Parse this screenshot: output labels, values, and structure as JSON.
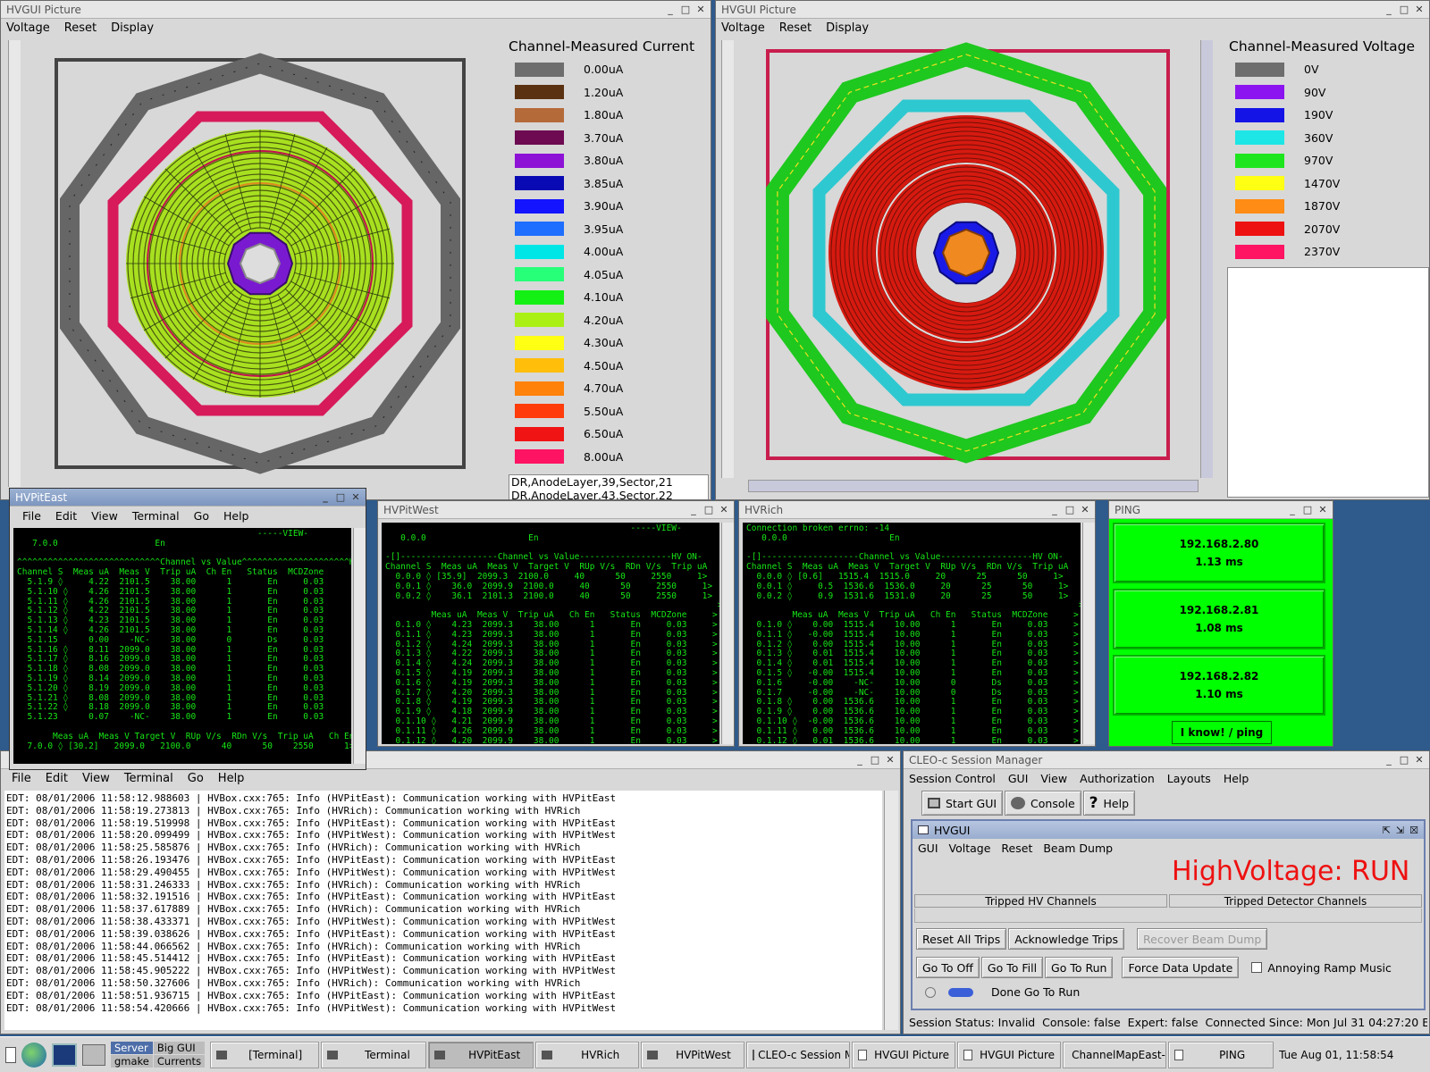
{
  "colors": {
    "bg": "#2f5a8c",
    "term_green": "#17e617",
    "ping_green": "#00ff00",
    "run_red": "#ee1111"
  },
  "win_current": {
    "title": "HVGUI Picture",
    "menu": [
      "Voltage",
      "Reset",
      "Display"
    ],
    "legend_title": "Channel-Measured Current",
    "legend": [
      {
        "color": "#6e6e6e",
        "label": "0.00uA"
      },
      {
        "color": "#5a3212",
        "label": "1.20uA"
      },
      {
        "color": "#b56a3a",
        "label": "1.80uA"
      },
      {
        "color": "#6e0a52",
        "label": "3.70uA"
      },
      {
        "color": "#8e12d6",
        "label": "3.80uA"
      },
      {
        "color": "#0a0ab4",
        "label": "3.85uA"
      },
      {
        "color": "#1414ff",
        "label": "3.90uA"
      },
      {
        "color": "#1e6eff",
        "label": "3.95uA"
      },
      {
        "color": "#00e6e6",
        "label": "4.00uA"
      },
      {
        "color": "#28ff78",
        "label": "4.05uA"
      },
      {
        "color": "#14f014",
        "label": "4.10uA"
      },
      {
        "color": "#aaf014",
        "label": "4.20uA"
      },
      {
        "color": "#ffff14",
        "label": "4.30uA"
      },
      {
        "color": "#ffbe0a",
        "label": "4.50uA"
      },
      {
        "color": "#ff820a",
        "label": "4.70uA"
      },
      {
        "color": "#ff3c0a",
        "label": "5.50uA"
      },
      {
        "color": "#f01414",
        "label": "6.50uA"
      },
      {
        "color": "#ff1464",
        "label": "8.00uA"
      }
    ],
    "info_lines": [
      "DR,AnodeLayer,39,Sector,21",
      "DR,AnodeLayer,43,Sector,22"
    ]
  },
  "win_voltage": {
    "title": "HVGUI Picture",
    "menu": [
      "Voltage",
      "Reset",
      "Display"
    ],
    "legend_title": "Channel-Measured Voltage",
    "legend": [
      {
        "color": "#6e6e6e",
        "label": "0V"
      },
      {
        "color": "#8c14f0",
        "label": "90V"
      },
      {
        "color": "#1414e6",
        "label": "190V"
      },
      {
        "color": "#1ee6e6",
        "label": "360V"
      },
      {
        "color": "#1ee61e",
        "label": "970V"
      },
      {
        "color": "#ffff14",
        "label": "1470V"
      },
      {
        "color": "#ff8c14",
        "label": "1870V"
      },
      {
        "color": "#ee1111",
        "label": "2070V"
      },
      {
        "color": "#ff1464",
        "label": "2370V"
      }
    ]
  },
  "hvpiteast": {
    "title": "HVPitEast",
    "menu": [
      "File",
      "Edit",
      "View",
      "Terminal",
      "Go",
      "Help"
    ],
    "text": "                                               -----VIEW-\n   7.0.0                   En\n\n^^^^^^^^^^^^^^^^^^^^^^^^^^^^Channel vs Value^^^^^^^^^^^^^^^^^^^^^HV ON^\nChannel S  Meas uA  Meas V  Trip uA  Ch En   Status  MCDZone      >\n  5.1.9 ◊     4.22  2101.5    38.00      1       En     0.03      >\n  5.1.10 ◊    4.26  2101.5    38.00      1       En     0.03      >\n  5.1.11 ◊    4.26  2101.5    38.00      1       En     0.03      >\n  5.1.12 ◊    4.22  2101.5    38.00      1       En     0.03      >\n  5.1.13 ◊    4.23  2101.5    38.00      1       En     0.03      >\n  5.1.14 ◊    4.26  2101.5    38.00      1       En     0.03      >\n  5.1.15      0.00    -NC-    38.00      0       Ds     0.03      >\n  5.1.16 ◊    8.11  2099.0    38.00      1       En     0.03      >\n  5.1.17 ◊    8.16  2099.0    38.00      1       En     0.03      >\n  5.1.18 ◊    8.08  2099.0    38.00      1       En     0.03      >\n  5.1.19 ◊    8.14  2099.0    38.00      1       En     0.03      >\n  5.1.20 ◊    8.19  2099.0    38.00      1       En     0.03      >\n  5.1.21 ◊    8.08  2099.0    38.00      1       En     0.03      >\n  5.1.22 ◊    8.18  2099.0    38.00      1       En     0.03      >\n  5.1.23      0.07    -NC-    38.00      1       En     0.03      >\n\n       Meas uA  Meas V Target V  RUp V/s  RDn V/s  Trip uA   Ch En>\n  7.0.0 ◊ [30.2]   2099.0   2100.0      40      50    2550      1>"
  },
  "hvpitwest": {
    "title": "HVPitWest",
    "text": "                                                -----VIEW-\n   0.0.0                    En\n\n-[]-------------------Channel vs Value------------------HV ON-\nChannel S  Meas uA  Meas V  Target V  RUp V/s  RDn V/s  Trip uA   Ch En\n  0.0.0 ◊ [35.9]  2099.3  2100.0     40      50     2550     1>\n  0.0.1 ◊    36.0  2099.9  2100.0     40      50     2550     1>\n  0.0.2 ◊    36.1  2101.3  2100.0     40      50     2550     1>\n                                                                 >\n         Meas uA  Meas V  Trip uA   Ch En   Status  MCDZone     >\n  0.1.0 ◊    4.23  2099.3    38.00      1       En     0.03     >\n  0.1.1 ◊    4.23  2099.3    38.00      1       En     0.03     >\n  0.1.2 ◊    4.24  2099.3    38.00      1       En     0.03     >\n  0.1.3 ◊    4.22  2099.3    38.00      1       En     0.03     >\n  0.1.4 ◊    4.24  2099.3    38.00      1       En     0.03     >\n  0.1.5 ◊    4.19  2099.3    38.00      1       En     0.03     >\n  0.1.6 ◊    4.19  2099.3    38.00      1       En     0.03     >\n  0.1.7 ◊    4.20  2099.3    38.00      1       En     0.03     >\n  0.1.8 ◊    4.19  2099.3    38.00      1       En     0.03     >\n  0.1.9 ◊    4.18  2099.9    38.00      1       En     0.03     >\n  0.1.10 ◊   4.21  2099.9    38.00      1       En     0.03     >\n  0.1.11 ◊   4.26  2099.9    38.00      1       En     0.03     >\n  0.1.12 ◊   4.20  2099.9    38.00      1       En     0.03     >"
  },
  "hvrich": {
    "title": "HVRich",
    "text": "Connection broken errno: -14\n   0.0.0                    En\n\n-[]-------------------Channel vs Value------------------HV ON-\nChannel S  Meas uA  Meas V  Target V  RUp V/s  RDn V/s  Trip uA   Ch En\n  0.0.0 ◊ [0.6]   1515.4  1515.0     20      25      50     1>\n  0.0.1 ◊     0.5  1536.6  1536.0     20      25      50     1>\n  0.0.2 ◊     0.9  1531.6  1531.0     20      25      50     1>\n                                                                 >\n         Meas uA  Meas V  Trip uA   Ch En   Status  MCDZone     >\n  0.1.0 ◊    0.00  1515.4    10.00      1       En     0.03     >\n  0.1.1 ◊   -0.00  1515.4    10.00      1       En     0.03     >\n  0.1.2 ◊    0.00  1515.4    10.00      1       En     0.03     >\n  0.1.3 ◊    0.01  1515.4    10.00      1       En     0.03     >\n  0.1.4 ◊    0.01  1515.4    10.00      1       En     0.03     >\n  0.1.5 ◊   -0.00  1515.4    10.00      1       En     0.03     >\n  0.1.6     -0.00    -NC-    10.00      0       Ds     0.03     >\n  0.1.7     -0.00    -NC-    10.00      0       Ds     0.03     >\n  0.1.8 ◊    0.00  1536.6    10.00      1       En     0.03     >\n  0.1.9 ◊    0.00  1536.6    10.00      1       En     0.03     >\n  0.1.10 ◊  -0.00  1536.6    10.00      1       En     0.03     >\n  0.1.11 ◊   0.00  1536.6    10.00      1       En     0.03     >\n  0.1.12 ◊   0.01  1536.6    10.00      1       En     0.03     >"
  },
  "ping": {
    "title": "PING",
    "hosts": [
      {
        "ip": "192.168.2.80",
        "ms": "1.13 ms"
      },
      {
        "ip": "192.168.2.81",
        "ms": "1.08 ms"
      },
      {
        "ip": "192.168.2.82",
        "ms": "1.10 ms"
      }
    ],
    "button": "I know! / ping"
  },
  "terminal": {
    "menu": [
      "File",
      "Edit",
      "View",
      "Terminal",
      "Go",
      "Help"
    ],
    "log": "EDT: 08/01/2006 11:58:12.988603 | HVBox.cxx:765: Info (HVPitEast): Communication working with HVPitEast\nEDT: 08/01/2006 11:58:19.273813 | HVBox.cxx:765: Info (HVRich): Communication working with HVRich\nEDT: 08/01/2006 11:58:19.519998 | HVBox.cxx:765: Info (HVPitEast): Communication working with HVPitEast\nEDT: 08/01/2006 11:58:20.099499 | HVBox.cxx:765: Info (HVPitWest): Communication working with HVPitWest\nEDT: 08/01/2006 11:58:25.585876 | HVBox.cxx:765: Info (HVRich): Communication working with HVRich\nEDT: 08/01/2006 11:58:26.193476 | HVBox.cxx:765: Info (HVPitEast): Communication working with HVPitEast\nEDT: 08/01/2006 11:58:29.490455 | HVBox.cxx:765: Info (HVPitWest): Communication working with HVPitWest\nEDT: 08/01/2006 11:58:31.246333 | HVBox.cxx:765: Info (HVRich): Communication working with HVRich\nEDT: 08/01/2006 11:58:32.191516 | HVBox.cxx:765: Info (HVPitEast): Communication working with HVPitEast\nEDT: 08/01/2006 11:58:37.617889 | HVBox.cxx:765: Info (HVRich): Communication working with HVRich\nEDT: 08/01/2006 11:58:38.433371 | HVBox.cxx:765: Info (HVPitWest): Communication working with HVPitWest\nEDT: 08/01/2006 11:58:39.038626 | HVBox.cxx:765: Info (HVPitEast): Communication working with HVPitEast\nEDT: 08/01/2006 11:58:44.066562 | HVBox.cxx:765: Info (HVRich): Communication working with HVRich\nEDT: 08/01/2006 11:58:45.514412 | HVBox.cxx:765: Info (HVPitEast): Communication working with HVPitEast\nEDT: 08/01/2006 11:58:45.905222 | HVBox.cxx:765: Info (HVPitWest): Communication working with HVPitWest\nEDT: 08/01/2006 11:58:50.327606 | HVBox.cxx:765: Info (HVRich): Communication working with HVRich\nEDT: 08/01/2006 11:58:51.936715 | HVBox.cxx:765: Info (HVPitEast): Communication working with HVPitEast\nEDT: 08/01/2006 11:58:54.420666 | HVBox.cxx:765: Info (HVPitWest): Communication working with HVPitWest"
  },
  "session": {
    "title": "CLEO-c Session Manager",
    "menu": [
      "Session Control",
      "GUI",
      "View",
      "Authorization",
      "Layouts",
      "Help"
    ],
    "tools": {
      "start": "Start GUI",
      "console": "Console",
      "help": "Help"
    },
    "hvgui": {
      "title": "HVGUI",
      "menu": [
        "GUI",
        "Voltage",
        "Reset",
        "Beam Dump"
      ],
      "status": "HighVoltage: RUN",
      "col1": "Tripped HV Channels",
      "col2": "Tripped Detector Channels",
      "b_reset": "Reset All Trips",
      "b_ack": "Acknowledge Trips",
      "b_recover": "Recover Beam Dump",
      "b_off": "Go To Off",
      "b_fill": "Go To Fill",
      "b_run": "Go To Run",
      "b_force": "Force Data Update",
      "music": "Annoying Ramp Music",
      "done": "Done Go To Run"
    },
    "statusbar": "Session Status: Invalid  Console: false  Expert: false  Connected Since: Mon Jul 31 04:27:20 EDT"
  },
  "taskbar": {
    "launcher1": "Server",
    "launcher2": "gmake",
    "launcher3": "Big GUI",
    "launcher4": "Currents",
    "tasks": [
      "[Terminal]",
      "Terminal",
      "HVPitEast",
      "HVRich",
      "HVPitWest",
      "CLEO-c Session M",
      "HVGUI Picture",
      "HVGUI Picture",
      "ChannelMapEast-",
      "PING"
    ],
    "clock": "Tue Aug 01, 11:58:54"
  }
}
